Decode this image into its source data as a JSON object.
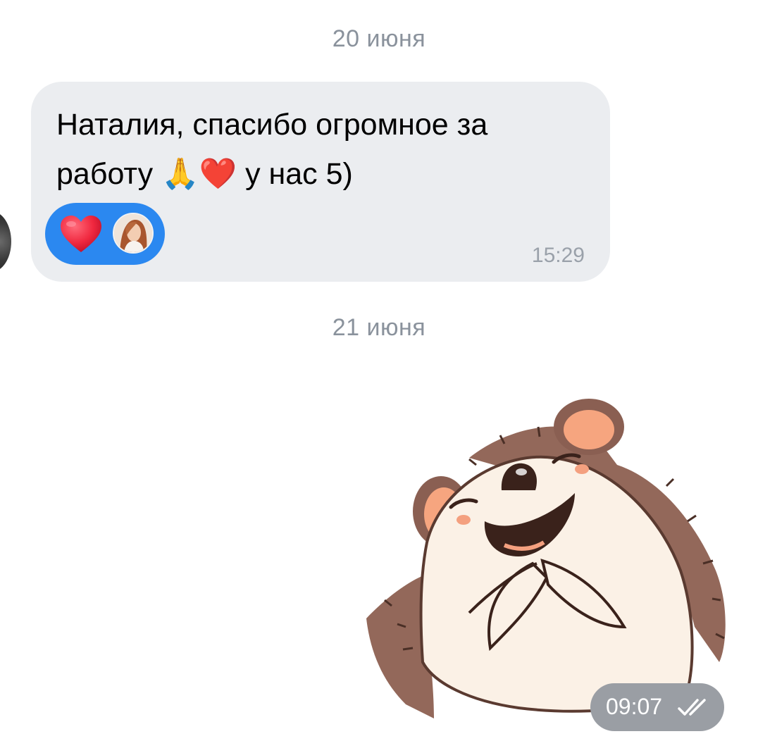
{
  "dates": {
    "first": "20 июня",
    "second": "21 июня"
  },
  "incoming_message": {
    "text": "Наталия, спасибо огромное за работу 🙏❤️ у нас 5)",
    "time": "15:29",
    "reaction": {
      "emoji": "heart-icon",
      "color": "#2b88f0"
    }
  },
  "sticker_message": {
    "sticker": "hedgehog-sticker",
    "time": "09:07",
    "status": "read-check-icon"
  },
  "colors": {
    "bubble": "#ebedf0",
    "date_text": "#8a929c",
    "reaction_pill": "#2b88f0",
    "time_pill": "#9a9ea4"
  }
}
